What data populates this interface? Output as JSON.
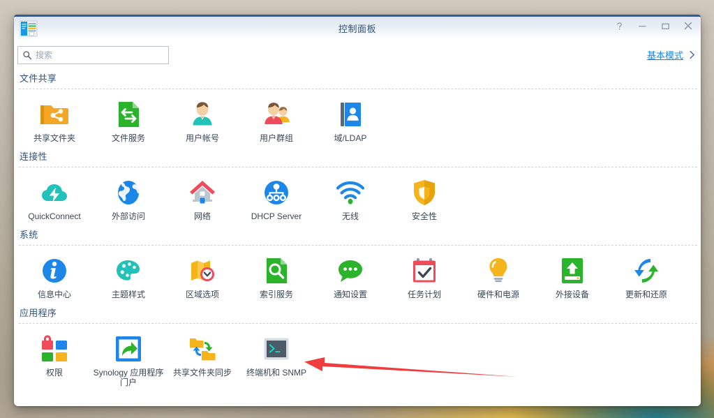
{
  "window": {
    "title": "控制面板",
    "app_icon": "control-panel-icon",
    "controls": [
      {
        "name": "help-button",
        "glyph": "?"
      },
      {
        "name": "minimize-button",
        "glyph": "–"
      },
      {
        "name": "maximize-button",
        "glyph": "□"
      },
      {
        "name": "close-button",
        "glyph": "✕"
      }
    ]
  },
  "toolbar": {
    "search_placeholder": "搜索",
    "search_value": "",
    "search_icon": "search-icon",
    "mode_label": "基本模式",
    "mode_chevron": "chevron-right-icon"
  },
  "sections": [
    {
      "id": "file-sharing",
      "title": "文件共享",
      "items": [
        {
          "label": "共享文件夹",
          "icon": "shared-folder-icon"
        },
        {
          "label": "文件服务",
          "icon": "file-services-icon"
        },
        {
          "label": "用户帐号",
          "icon": "user-account-icon"
        },
        {
          "label": "用户群组",
          "icon": "user-group-icon"
        },
        {
          "label": "域/LDAP",
          "icon": "domain-ldap-icon"
        }
      ]
    },
    {
      "id": "connectivity",
      "title": "连接性",
      "items": [
        {
          "label": "QuickConnect",
          "icon": "quickconnect-cloud-icon"
        },
        {
          "label": "外部访问",
          "icon": "external-access-globe-icon"
        },
        {
          "label": "网络",
          "icon": "network-house-icon"
        },
        {
          "label": "DHCP Server",
          "icon": "dhcp-server-icon"
        },
        {
          "label": "无线",
          "icon": "wireless-wifi-icon"
        },
        {
          "label": "安全性",
          "icon": "security-shield-icon"
        }
      ]
    },
    {
      "id": "system",
      "title": "系统",
      "items": [
        {
          "label": "信息中心",
          "icon": "info-center-icon"
        },
        {
          "label": "主题样式",
          "icon": "theme-palette-icon"
        },
        {
          "label": "区域选项",
          "icon": "regional-options-icon"
        },
        {
          "label": "索引服务",
          "icon": "indexing-service-icon"
        },
        {
          "label": "通知设置",
          "icon": "notification-bubble-icon"
        },
        {
          "label": "任务计划",
          "icon": "task-scheduler-icon"
        },
        {
          "label": "硬件和电源",
          "icon": "hardware-power-bulb-icon"
        },
        {
          "label": "外接设备",
          "icon": "external-devices-icon"
        },
        {
          "label": "更新和还原",
          "icon": "update-restore-icon"
        }
      ]
    },
    {
      "id": "application",
      "title": "应用程序",
      "items": [
        {
          "label": "权限",
          "icon": "privileges-lock-icon"
        },
        {
          "label": "Synology 应用程序门户",
          "icon": "application-portal-icon"
        },
        {
          "label": "共享文件夹同步",
          "icon": "shared-folder-sync-icon"
        },
        {
          "label": "终端机和 SNMP",
          "icon": "terminal-snmp-icon"
        }
      ]
    }
  ],
  "annotation": {
    "arrow": {
      "name": "red-pointer-arrow",
      "color": "#f03c3c",
      "points_to": "终端机和 SNMP"
    }
  }
}
